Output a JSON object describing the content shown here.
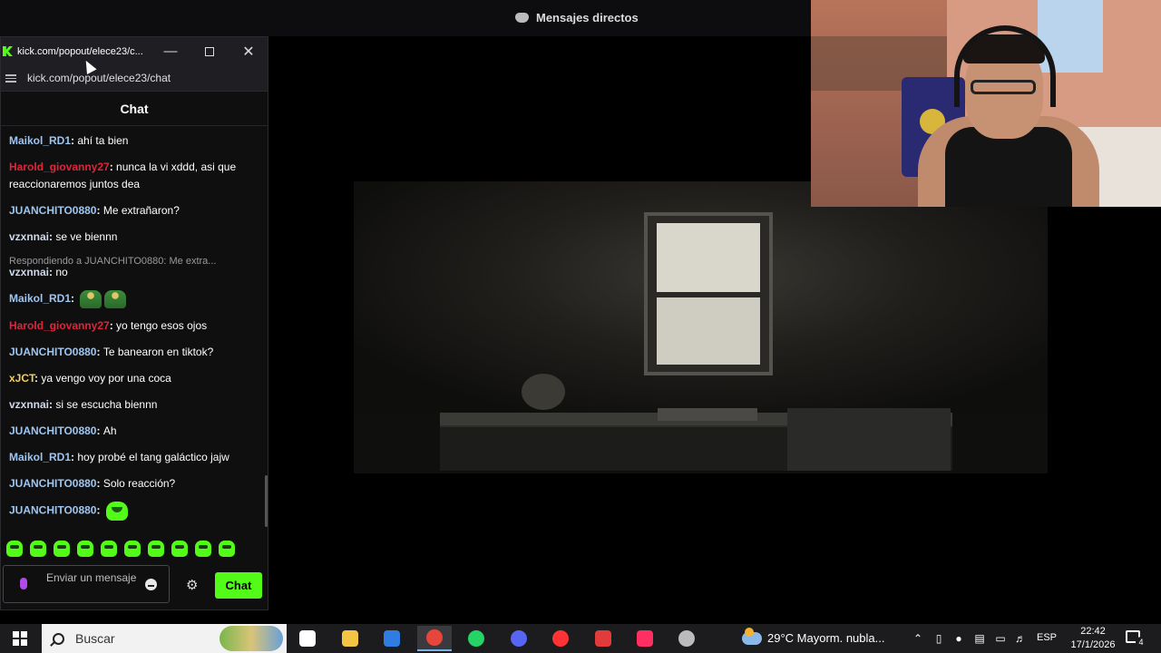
{
  "background": {
    "discord_title": "Mensajes directos"
  },
  "chat_window": {
    "title": "kick.com/popout/elece23/c...",
    "address": "kick.com/popout/elece23/chat",
    "header": "Chat",
    "messages": [
      {
        "user": "Maikol_RD1",
        "color": "#9ec5f0",
        "text": "ahí ta bien"
      },
      {
        "user": "Harold_giovanny27",
        "color": "#e0243a",
        "text": "nunca la vi xddd, asi que reaccionaremos juntos dea"
      },
      {
        "user": "JUANCHITO0880",
        "color": "#9ec5f0",
        "text": "Me extrañaron?"
      },
      {
        "user": "vzxnnai",
        "color": "#cfd8e8",
        "text": "se ve biennn"
      },
      {
        "user": "vzxnnai",
        "color": "#cfd8e8",
        "text": "no",
        "reply_to": "Respondiendo a JUANCHITO0880: Me extra..."
      },
      {
        "user": "Maikol_RD1",
        "color": "#9ec5f0",
        "text": "",
        "emotes": [
          "emote-worm",
          "emote-worm"
        ]
      },
      {
        "user": "Harold_giovanny27",
        "color": "#e0243a",
        "text": "yo tengo esos ojos"
      },
      {
        "user": "JUANCHITO0880",
        "color": "#9ec5f0",
        "text": "Te banearon en tiktok?"
      },
      {
        "user": "xJCT",
        "color": "#f0d060",
        "text": "ya vengo voy por una coca"
      },
      {
        "user": "vzxnnai",
        "color": "#cfd8e8",
        "text": "si se escucha biennn"
      },
      {
        "user": "JUANCHITO0880",
        "color": "#9ec5f0",
        "text": "Ah"
      },
      {
        "user": "Maikol_RD1",
        "color": "#9ec5f0",
        "text": "hoy probé el tang galáctico jajw"
      },
      {
        "user": "JUANCHITO0880",
        "color": "#9ec5f0",
        "text": "Solo reacción?"
      },
      {
        "user": "JUANCHITO0880",
        "color": "#9ec5f0",
        "text": "",
        "emotes": [
          "emote-blob"
        ]
      }
    ],
    "emote_bar_count": 10,
    "input_placeholder": "Enviar un mensaje",
    "send_label": "Chat",
    "accent": "#53fc18"
  },
  "taskbar": {
    "search_placeholder": "Buscar",
    "weather": "29°C  Mayorm. nubla...",
    "language": "ESP",
    "time": "22:42",
    "date": "17/1/2026",
    "notification_count": "4",
    "apps": [
      {
        "name": "task-view-icon",
        "color": "#ffffff"
      },
      {
        "name": "file-explorer-icon",
        "color": "#f4c542"
      },
      {
        "name": "microsoft-store-icon",
        "color": "#2f7de1"
      },
      {
        "name": "chrome-icon",
        "color": "#e8453c"
      },
      {
        "name": "whatsapp-icon",
        "color": "#25d366"
      },
      {
        "name": "discord-icon",
        "color": "#5865f2"
      },
      {
        "name": "youtube-icon",
        "color": "#ff3333"
      },
      {
        "name": "tf-app-icon",
        "color": "#e23b3b"
      },
      {
        "name": "tiktok-icon",
        "color": "#ff2e63"
      },
      {
        "name": "recorder-icon",
        "color": "#bbbbbb"
      }
    ]
  }
}
